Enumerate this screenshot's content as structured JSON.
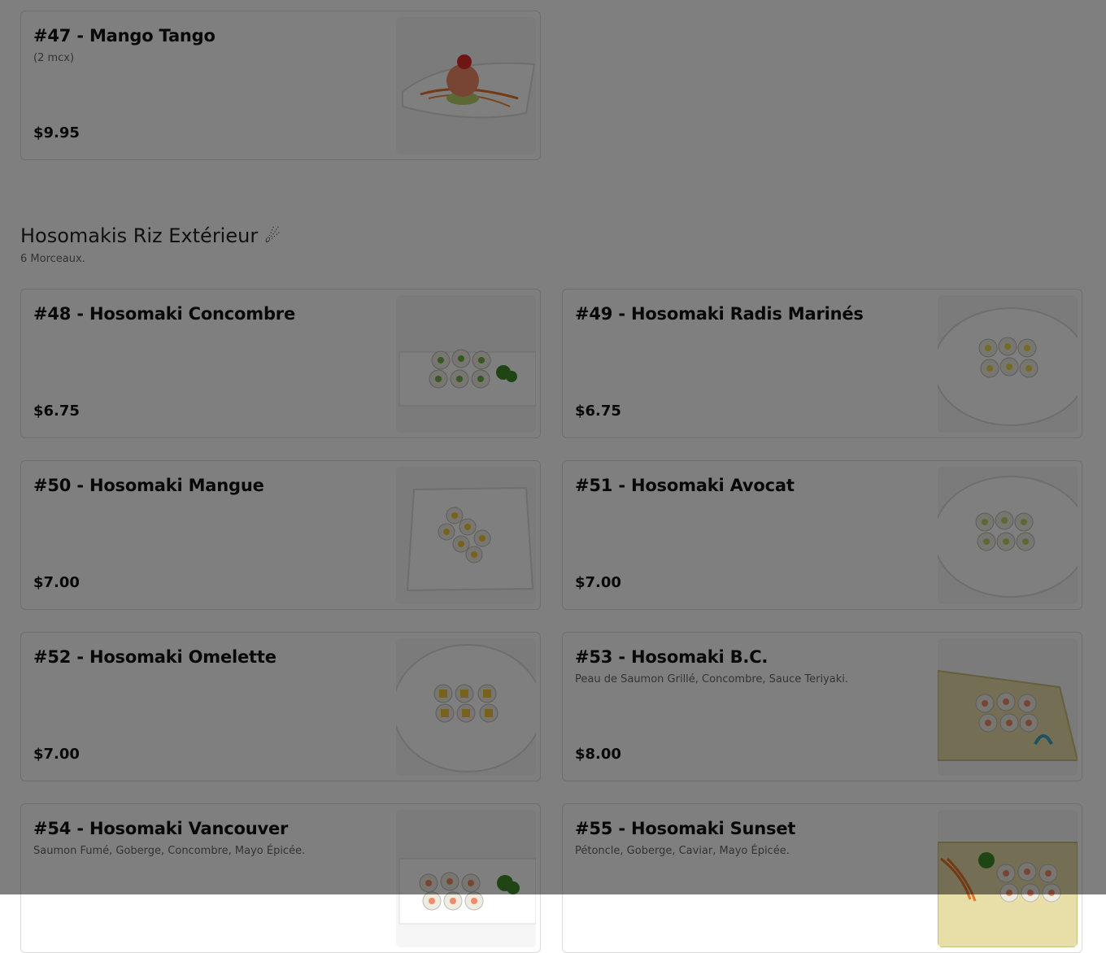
{
  "top_item": {
    "title": "#47 - Mango Tango",
    "description": "(2 mcx)",
    "price": "$9.95",
    "image": "mango-tango-photo"
  },
  "section": {
    "title": "Hosomakis Riz Extérieur",
    "title_icon": "comet-icon",
    "subtitle": "6 Morceaux."
  },
  "items": [
    {
      "title": "#48 - Hosomaki Concombre",
      "description": "",
      "price": "$6.75",
      "image": "hosomaki-concombre-photo"
    },
    {
      "title": "#49 - Hosomaki Radis Marinés",
      "description": "",
      "price": "$6.75",
      "image": "hosomaki-radis-photo"
    },
    {
      "title": "#50 - Hosomaki Mangue",
      "description": "",
      "price": "$7.00",
      "image": "hosomaki-mangue-photo"
    },
    {
      "title": "#51 - Hosomaki Avocat",
      "description": "",
      "price": "$7.00",
      "image": "hosomaki-avocat-photo"
    },
    {
      "title": "#52 - Hosomaki Omelette",
      "description": "",
      "price": "$7.00",
      "image": "hosomaki-omelette-photo"
    },
    {
      "title": "#53 - Hosomaki B.C.",
      "description": "Peau de Saumon Grillé, Concombre, Sauce Teriyaki.",
      "price": "$8.00",
      "image": "hosomaki-bc-photo"
    },
    {
      "title": "#54 - Hosomaki Vancouver",
      "description": "Saumon Fumé, Goberge, Concombre, Mayo Épicée.",
      "price": "",
      "image": "hosomaki-vancouver-photo"
    },
    {
      "title": "#55 - Hosomaki Sunset",
      "description": "Pétoncle, Goberge, Caviar, Mayo Épicée.",
      "price": "",
      "image": "hosomaki-sunset-photo"
    }
  ],
  "colors": {
    "overlay": "#000000",
    "card_border": "#dcdcdc",
    "plate": "#ffffff",
    "boat_plate": "#e8dfa8",
    "avocado": "#b8d36a",
    "mango": "#f2c53d",
    "salmon": "#f08a6a"
  }
}
